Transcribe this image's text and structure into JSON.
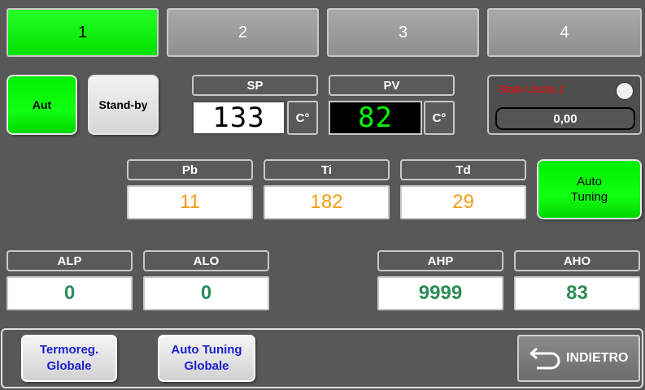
{
  "tabs": [
    {
      "label": "1",
      "active": true
    },
    {
      "label": "2",
      "active": false
    },
    {
      "label": "3",
      "active": false
    },
    {
      "label": "4",
      "active": false
    }
  ],
  "mode": {
    "aut_label": "Aut",
    "standby_label": "Stand-by"
  },
  "sp": {
    "label": "SP",
    "value": "133",
    "unit": "C°"
  },
  "pv": {
    "label": "PV",
    "value": "82",
    "unit": "C°"
  },
  "output": {
    "label": "Stato Uscita 1",
    "value": "0,00"
  },
  "pid": {
    "pb_label": "Pb",
    "pb_value": "11",
    "ti_label": "Ti",
    "ti_value": "182",
    "td_label": "Td",
    "td_value": "29"
  },
  "autotuning": {
    "line1": "Auto",
    "line2": "Tuning"
  },
  "alarms": {
    "alp_label": "ALP",
    "alp_value": "0",
    "alo_label": "ALO",
    "alo_value": "0",
    "ahp_label": "AHP",
    "ahp_value": "9999",
    "aho_label": "AHO",
    "aho_value": "83"
  },
  "footer": {
    "termoreg_line1": "Termoreg.",
    "termoreg_line2": "Globale",
    "autotuning_global_line1": "Auto Tuning",
    "autotuning_global_line2": "Globale",
    "back_label": "INDIETRO"
  },
  "colors": {
    "active_green": "#00ff00",
    "pv_green": "#00ff00",
    "warning_red": "#ff0000",
    "param_orange": "#f39c12",
    "alarm_teal": "#2e8b57",
    "link_blue": "#1d1dcc"
  }
}
